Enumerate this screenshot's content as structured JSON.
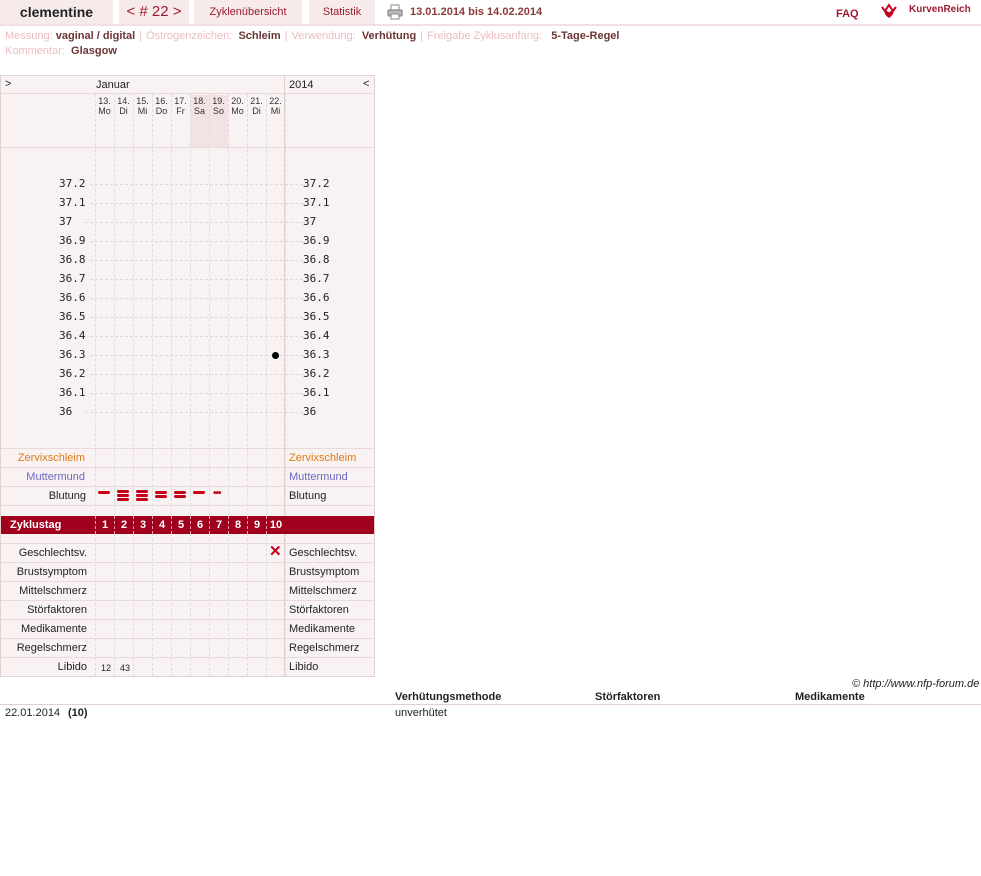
{
  "topbar": {
    "user": "clementine",
    "cycle": "< # 22 >",
    "overview": "Zyklenübersicht",
    "stats": "Statistik",
    "date_range": "13.01.2014 bis 14.02.2014",
    "faq": "FAQ",
    "brand": "KurvenReich",
    "printer_icon": "printer-icon",
    "logo_icon": "crown-heart-icon"
  },
  "meta": {
    "messung_label": "Messung:",
    "messung": "vaginal / digital",
    "oestrogen_label": "Östrogenzeichen:",
    "oestrogen": "Schleim",
    "verwendung_label": "Verwendung:",
    "verwendung": "Verhütung",
    "freigabe_label": "Freigabe Zyklusanfang:",
    "freigabe": "5-Tage-Regel",
    "kommentar_label": "Kommentar:",
    "kommentar": "Glasgow"
  },
  "chart": {
    "nav_next": ">",
    "nav_prev": "<",
    "month": "Januar",
    "year": "2014",
    "days": [
      {
        "date": "13.",
        "wd": "Mo"
      },
      {
        "date": "14.",
        "wd": "Di"
      },
      {
        "date": "15.",
        "wd": "Mi"
      },
      {
        "date": "16.",
        "wd": "Do"
      },
      {
        "date": "17.",
        "wd": "Fr"
      },
      {
        "date": "18.",
        "wd": "Sa"
      },
      {
        "date": "19.",
        "wd": "So"
      },
      {
        "date": "20.",
        "wd": "Mo"
      },
      {
        "date": "21.",
        "wd": "Di"
      },
      {
        "date": "22.",
        "wd": "Mi"
      }
    ],
    "temps": [
      "37.2",
      "37.1",
      "37",
      "36.9",
      "36.8",
      "36.7",
      "36.6",
      "36.5",
      "36.4",
      "36.3",
      "36.2",
      "36.1",
      "36"
    ],
    "measurement": {
      "day_index": 9,
      "temp": 36.3
    },
    "rows_top": {
      "zervix": "Zervixschleim",
      "muttermund": "Muttermund",
      "blutung": "Blutung"
    },
    "bleeding": [
      1,
      3,
      3,
      2,
      2,
      1,
      0.5,
      0,
      0,
      0
    ],
    "cycle_label": "Zyklustag",
    "cycle_days": [
      "1",
      "2",
      "3",
      "4",
      "5",
      "6",
      "7",
      "8",
      "9",
      "10"
    ],
    "intercourse_day_index": 9,
    "intercourse_icon": "cross-icon",
    "rows_bottom": [
      "Geschlechtsv.",
      "Brustsymptom",
      "Mittelschmerz",
      "Störfaktoren",
      "Medikamente",
      "Regelschmerz",
      "Libido"
    ],
    "libido_values": [
      "12",
      "43"
    ],
    "colors": {
      "cycle_bar": "#a0001e",
      "zervix": "#e07a17",
      "muttermund": "#6a6abf",
      "bleeding": "#c4001a"
    }
  },
  "copyright": "© http://www.nfp-forum.de",
  "table": {
    "headers": [
      "Verhütungsmethode",
      "Störfaktoren",
      "Medikamente"
    ],
    "row": {
      "date": "22.01.2014",
      "day": "(10)",
      "method": "unverhütet"
    }
  }
}
